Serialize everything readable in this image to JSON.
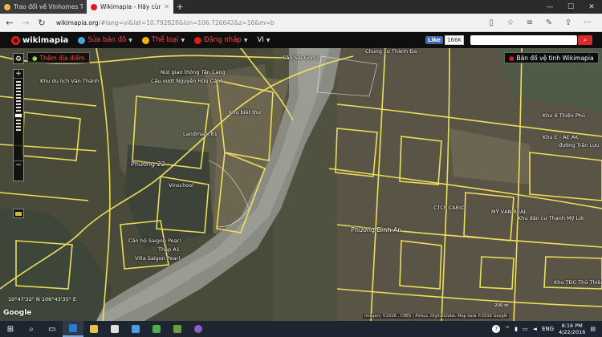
{
  "browser": {
    "tabs": [
      {
        "label": "Trao đổi về Vinhomes Tân C",
        "active": false,
        "icon": "forum-favicon"
      },
      {
        "label": "Wikimapia - Hãy cùng r",
        "active": true,
        "icon": "wikimapia-favicon"
      }
    ],
    "new_tab": "+",
    "url_host": "wikimapia.org",
    "url_rest": "/#lang=vi&lat=10.792828&lon=106.726642&z=16&m=b",
    "window_controls": [
      "—",
      "☐",
      "✕"
    ]
  },
  "toolbar": {
    "brand": "wikimapia",
    "edit_map": "Sửa bản đồ",
    "category": "Thể loại",
    "login": "Đăng nhập",
    "language": "VI",
    "fb_like": "Like",
    "fb_count": "166K",
    "search_placeholder": ""
  },
  "map": {
    "add_place": "Thêm địa điểm",
    "satellite_btn": "Bản đồ vệ tinh Wikimapia",
    "coords": "10°47'32\" N  106°43'35\" E",
    "attribution": "Imagery ©2016 , CNES / Airbus, DigitalGlobe, Map data ©2016 Google",
    "scale": "200 m",
    "google": "Google",
    "labels": [
      {
        "text": "Cầu Sài Gòn 2",
        "big": false
      },
      {
        "text": "Chung cư Thành Đa",
        "big": false
      },
      {
        "text": "Khu du lịch Văn Thánh",
        "big": false
      },
      {
        "text": "Nút giao thông Tân Cảng",
        "big": false
      },
      {
        "text": "Cầu vượt Nguyễn Hữu Cảnh",
        "big": false
      },
      {
        "text": "Khu biệt thự",
        "big": false
      },
      {
        "text": "Landmark 81",
        "big": false
      },
      {
        "text": "Phường 22",
        "big": true
      },
      {
        "text": "Vinschool",
        "big": false
      },
      {
        "text": "Căn hộ Saigon Pearl",
        "big": false
      },
      {
        "text": "Tháp A1",
        "big": false
      },
      {
        "text": "Villa Saigon Pearl",
        "big": false
      },
      {
        "text": "Phường Bình An",
        "big": true
      },
      {
        "text": "CTCP CARIC",
        "big": false
      },
      {
        "text": "MỸ VẠN REAL",
        "big": false
      },
      {
        "text": "Khu dân cư Thạnh Mỹ Lợi",
        "big": false
      },
      {
        "text": "Khu 6 Thiện Phú",
        "big": false
      },
      {
        "text": "Khu E - AE AK",
        "big": false
      },
      {
        "text": "đường Trần Lựu",
        "big": false
      },
      {
        "text": "Khu TĐC Thủ Thiêm",
        "big": false
      }
    ]
  },
  "taskbar": {
    "language": "ENG",
    "time": "8:16 PM",
    "date": "4/22/2016"
  }
}
